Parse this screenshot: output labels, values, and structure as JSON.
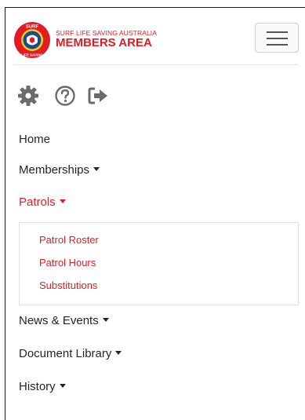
{
  "brand": {
    "tagline": "SURF LIFE SAVING AUSTRALIA",
    "title": "MEMBERS AREA",
    "logo_text_top": "SURF",
    "logo_text_bottom": "LIFE SAVING",
    "colors": {
      "red": "#e31b23",
      "blue": "#1c4a8f",
      "yellow": "#f7d117"
    }
  },
  "toolbar": {
    "icons": [
      "gear-icon",
      "help-circle-icon",
      "sign-out-icon"
    ],
    "icon_color": "#6b6b6b"
  },
  "nav": {
    "items": [
      {
        "label": "Home",
        "dropdown": false
      },
      {
        "label": "Memberships",
        "dropdown": true
      },
      {
        "label": "Patrols",
        "dropdown": true,
        "active": true
      },
      {
        "label": "News & Events",
        "dropdown": true
      },
      {
        "label": "Document Library",
        "dropdown": true
      },
      {
        "label": "History",
        "dropdown": true
      }
    ],
    "patrols_submenu": [
      {
        "label": "Patrol Roster"
      },
      {
        "label": "Patrol Hours"
      },
      {
        "label": "Substitutions"
      }
    ]
  }
}
